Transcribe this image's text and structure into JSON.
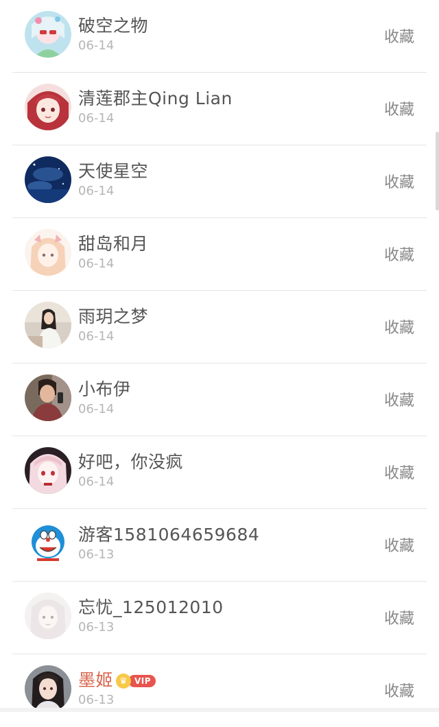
{
  "list": {
    "items": [
      {
        "name": "破空之物",
        "date": "06-14",
        "action": "收藏"
      },
      {
        "name": "清莲郡主Qing Lian",
        "date": "06-14",
        "action": "收藏"
      },
      {
        "name": "天使星空",
        "date": "06-14",
        "action": "收藏"
      },
      {
        "name": "甜岛和月",
        "date": "06-14",
        "action": "收藏"
      },
      {
        "name": "雨玥之梦",
        "date": "06-14",
        "action": "收藏"
      },
      {
        "name": "小布伊",
        "date": "06-14",
        "action": "收藏"
      },
      {
        "name": "好吧，你没疯",
        "date": "06-14",
        "action": "收藏"
      },
      {
        "name": "游客1581064659684",
        "date": "06-13",
        "action": "收藏"
      },
      {
        "name": "忘忧_125012010",
        "date": "06-13",
        "action": "收藏"
      },
      {
        "name": "墨姬",
        "date": "06-13",
        "action": "收藏",
        "vip_label": "VIP"
      }
    ]
  },
  "colors": {
    "name_text": "#555555",
    "vip_name_text": "#d8654a",
    "date_text": "#b5b5b5",
    "action_text": "#888888",
    "vip_badge": "#e8544e"
  }
}
